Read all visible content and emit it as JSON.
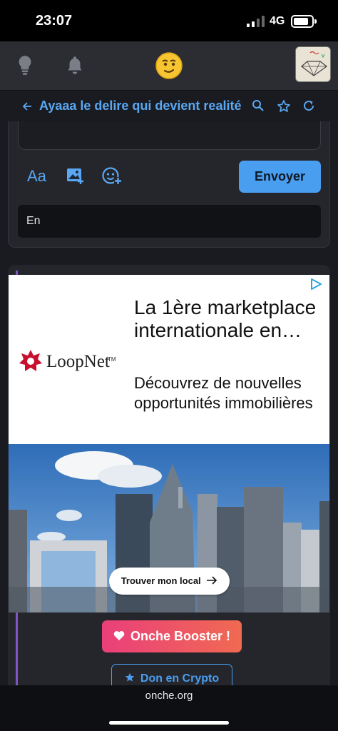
{
  "status_bar": {
    "time": "23:07",
    "network": "4G"
  },
  "app_bar": {
    "icons": [
      "lightbulb-icon",
      "bell-icon",
      "smiley-logo",
      "user-avatar"
    ]
  },
  "topic": {
    "title": "Ayaaa le delire qui devient realité",
    "icons": [
      "back-arrow-icon",
      "search-icon",
      "star-icon",
      "refresh-icon"
    ]
  },
  "compose": {
    "format_label": "Aa",
    "send_label": "Envoyer",
    "language_value": "En"
  },
  "ad": {
    "brand": "LoopNet",
    "brand_tm": "TM",
    "headline": "La 1ère marketplace internationale en…",
    "description": "Découvrez de nouvelles opportunités immobilières",
    "cta": "Trouver mon local"
  },
  "buttons": {
    "booster": "Onche Booster !",
    "crypto": "Don en Crypto"
  },
  "browser": {
    "url": "onche.org"
  },
  "colors": {
    "accent": "#4a9ef0",
    "booster_start": "#ea3f7a",
    "booster_end": "#f06a52",
    "post_bar": "#7e57c2"
  }
}
